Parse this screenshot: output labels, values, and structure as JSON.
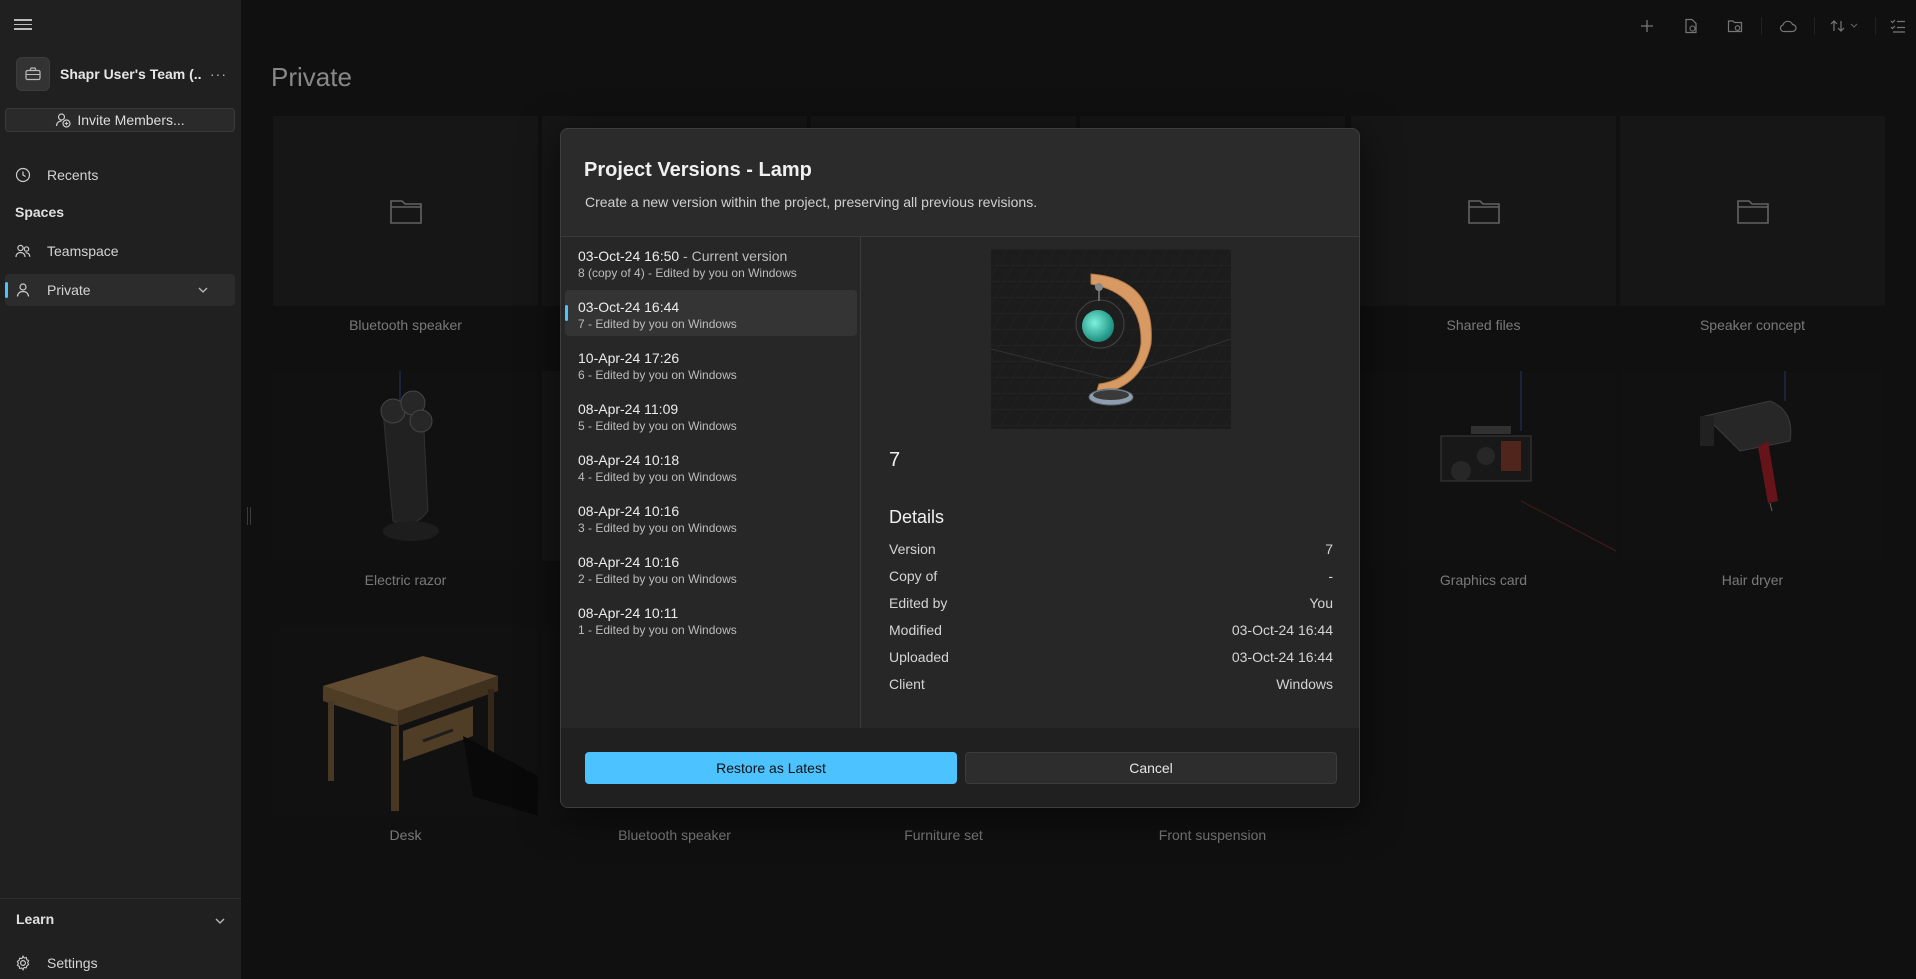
{
  "sidebar": {
    "team_name": "Shapr User's Team (...",
    "more_label": "···",
    "invite_label": "Invite Members...",
    "recents_label": "Recents",
    "spaces_label": "Spaces",
    "teamspace_label": "Teamspace",
    "private_label": "Private",
    "learn_label": "Learn",
    "settings_label": "Settings"
  },
  "main": {
    "title": "Private",
    "cards": [
      {
        "label": "Bluetooth speaker",
        "thumb": "folder-icon"
      },
      {
        "label": "Shared files",
        "thumb": "folder-icon"
      },
      {
        "label": "Speaker concept",
        "thumb": "folder-icon"
      },
      {
        "label": "Electric razor",
        "thumb": "razor-model"
      },
      {
        "label": "Graphics card",
        "thumb": "graphics-card-model"
      },
      {
        "label": "Hair dryer",
        "thumb": "hair-dryer-model"
      },
      {
        "label": "Desk",
        "thumb": "desk-model"
      },
      {
        "label": "Bluetooth speaker",
        "thumb": "speaker-model"
      },
      {
        "label": "Furniture set",
        "thumb": "furniture-model"
      },
      {
        "label": "Front suspension",
        "thumb": "suspension-model"
      }
    ]
  },
  "dialog": {
    "title": "Project Versions - Lamp",
    "subtitle": "Create a new version within the project, preserving all previous revisions.",
    "versions": [
      {
        "date": "03-Oct-24 16:50",
        "current": " - Current version",
        "meta": "8 (copy of 4) - Edited by you on Windows"
      },
      {
        "date": "03-Oct-24 16:44",
        "current": "",
        "meta": "7 - Edited by you on Windows"
      },
      {
        "date": "10-Apr-24 17:26",
        "current": "",
        "meta": "6 - Edited by you on Windows"
      },
      {
        "date": "08-Apr-24 11:09",
        "current": "",
        "meta": "5 - Edited by you on Windows"
      },
      {
        "date": "08-Apr-24 10:18",
        "current": "",
        "meta": "4 - Edited by you on Windows"
      },
      {
        "date": "08-Apr-24 10:16",
        "current": "",
        "meta": "3 - Edited by you on Windows"
      },
      {
        "date": "08-Apr-24 10:16",
        "current": "",
        "meta": "2 - Edited by you on Windows"
      },
      {
        "date": "08-Apr-24 10:11",
        "current": "",
        "meta": "1 - Edited by you on Windows"
      }
    ],
    "selected_index": 1,
    "detail": {
      "version_number": "7",
      "heading": "Details",
      "rows": [
        {
          "label": "Version",
          "value": "7"
        },
        {
          "label": "Copy of",
          "value": "-"
        },
        {
          "label": "Edited by",
          "value": "You"
        },
        {
          "label": "Modified",
          "value": "03-Oct-24 16:44"
        },
        {
          "label": "Uploaded",
          "value": "03-Oct-24 16:44"
        },
        {
          "label": "Client",
          "value": "Windows"
        }
      ]
    },
    "restore_label": "Restore as Latest",
    "cancel_label": "Cancel"
  },
  "colors": {
    "accent": "#4cc2ff",
    "background": "#1c1c1c",
    "dialog": "#2b2b2b"
  }
}
